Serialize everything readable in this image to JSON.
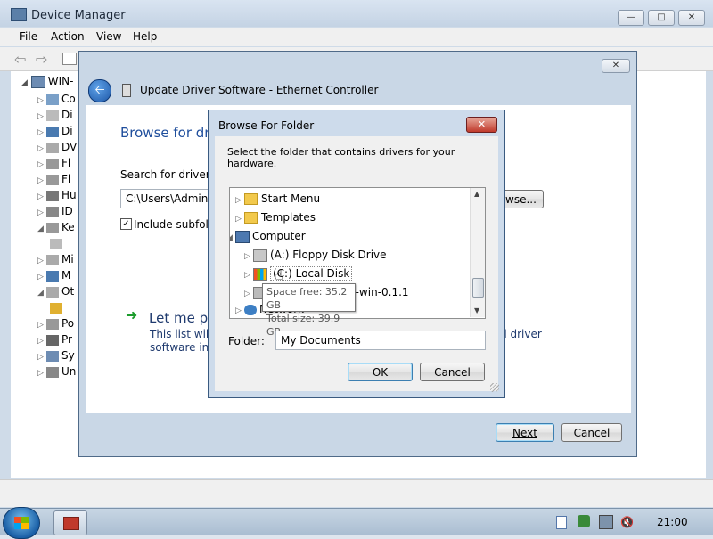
{
  "device_manager": {
    "title": "Device Manager",
    "menu": [
      {
        "label": "File"
      },
      {
        "label": "Action"
      },
      {
        "label": "View"
      },
      {
        "label": "Help"
      }
    ],
    "tree_root": "WIN-",
    "tree_items": [
      "Co",
      "Di",
      "Di",
      "DV",
      "Fl",
      "Fl",
      "Hu",
      "ID",
      "Ke",
      "",
      "Mi",
      "M",
      "Ot",
      "",
      "Po",
      "Pr",
      "Sy",
      "Un"
    ]
  },
  "update_wizard": {
    "title": "Update Driver Software - Ethernet Controller",
    "heading": "Browse for dri",
    "search_label": "Search for driver so",
    "path_value": "C:\\Users\\Adminis",
    "browse_label": "wse...",
    "include_subfolders": "Include subfold",
    "include_checked": true,
    "let_me_pick": "Let me pi",
    "desc_line1": "This list will s",
    "desc_line2": "software in t",
    "desc_right1": "ll driver",
    "next_label": "Next",
    "cancel_label": "Cancel"
  },
  "browse_dialog": {
    "title": "Browse For Folder",
    "instruction": "Select the folder that contains drivers for your hardware.",
    "tree": [
      {
        "label": "Start Menu",
        "icon": "folder-shortcut-icon"
      },
      {
        "label": "Templates",
        "icon": "folder-shortcut-icon"
      },
      {
        "label": "Computer",
        "icon": "computer-icon"
      },
      {
        "label": "(A:) Floppy Disk Drive",
        "icon": "floppy-drive-icon"
      },
      {
        "label": "(C:) Local Disk",
        "icon": "local-disk-icon"
      },
      {
        "label": "tio-win-0.1.1",
        "icon": "cd-drive-icon"
      },
      {
        "label": "Network",
        "icon": "network-icon"
      }
    ],
    "tooltip_line1": "Space free: 35.2 GB",
    "tooltip_line2": "Total size: 39.9 GB",
    "folder_label": "Folder:",
    "folder_value": "My Documents",
    "ok_label": "OK",
    "cancel_label": "Cancel"
  },
  "taskbar": {
    "clock": "21:00"
  }
}
